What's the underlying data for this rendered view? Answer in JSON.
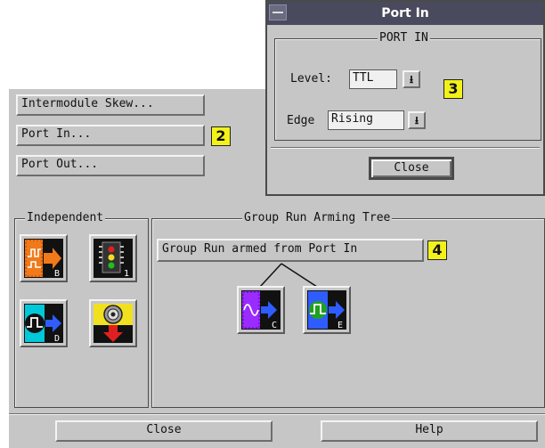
{
  "left_buttons": {
    "intermodule_skew": "Intermodule Skew...",
    "port_in": "Port In...",
    "port_out": "Port Out..."
  },
  "callouts": {
    "two": "2",
    "three": "3",
    "four": "4"
  },
  "independent": {
    "legend": "Independent",
    "icons": [
      {
        "name": "waveform-output-icon",
        "letter": "B"
      },
      {
        "name": "chip-traffic-light-icon",
        "letter": "1"
      },
      {
        "name": "pulse-output-icon",
        "letter": "D"
      },
      {
        "name": "bnc-connector-down-icon",
        "letter": ""
      }
    ]
  },
  "tree": {
    "legend": "Group Run Arming Tree",
    "armed_button": "Group Run armed from Port In",
    "children": [
      {
        "name": "sine-analyzer-icon",
        "letter": "C"
      },
      {
        "name": "pulse-analyzer-icon",
        "letter": "E"
      }
    ]
  },
  "bottom_bar": {
    "close": "Close",
    "help": "Help"
  },
  "port_in_dialog": {
    "title": "Port In",
    "group_legend": "PORT IN",
    "level_label": "Level:",
    "level_value": "TTL",
    "edge_label": "Edge",
    "edge_value": "Rising",
    "close": "Close",
    "dropdown_glyph": "⭳"
  },
  "colors": {
    "window_bg": "#c6c6c6",
    "titlebar": "#4a4a5e",
    "callout_yellow": "#f2f21a",
    "icon_orange": "#f07a1a",
    "icon_blue": "#2f5cff",
    "icon_cyan": "#00c8d8",
    "icon_purple": "#9a2cff",
    "icon_red": "#e02020",
    "icon_yellow": "#f0e020"
  }
}
